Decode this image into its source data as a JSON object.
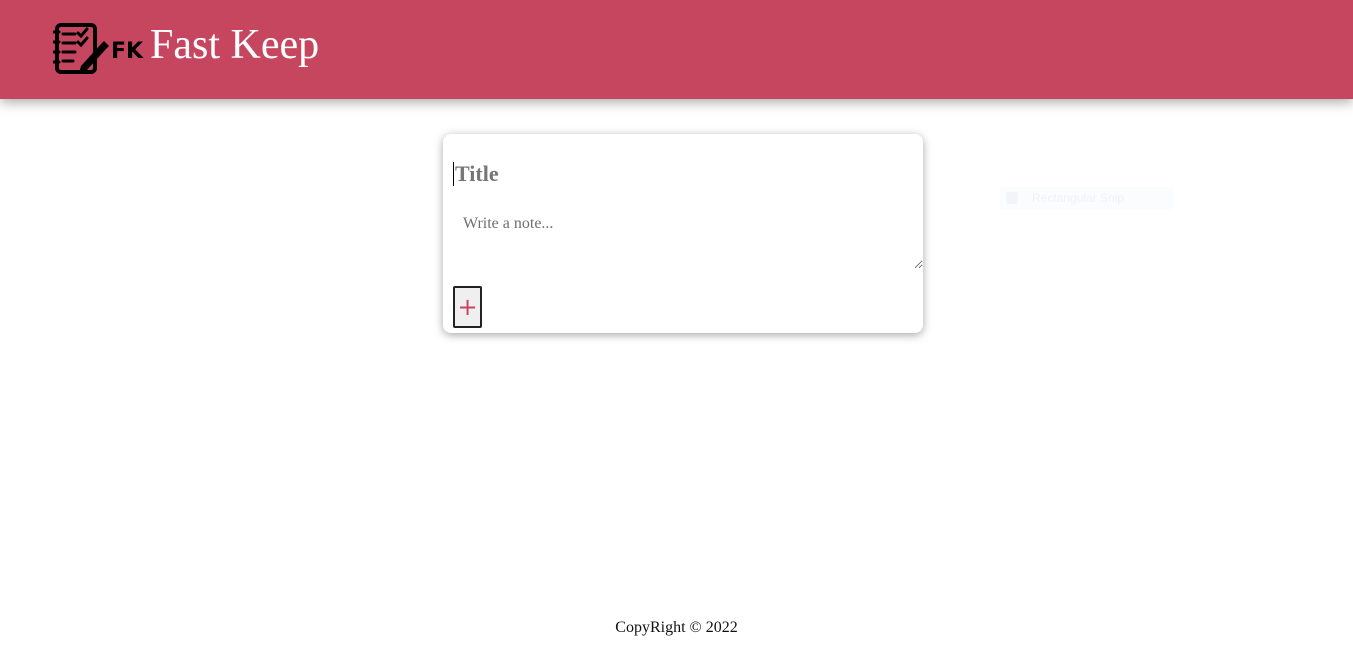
{
  "header": {
    "brand_title": "Fast Keep",
    "logo_icon": "notepad-checklist-pen-icon",
    "logo_text": "FK",
    "background_color": "#c64660"
  },
  "note_form": {
    "title_placeholder": "Title",
    "note_placeholder": "Write a note...",
    "add_button_label": "+",
    "add_icon": "plus-icon",
    "accent_color": "#c64660"
  },
  "ghost_widget": {
    "label": "Rectangular Snip"
  },
  "footer": {
    "text": "CopyRight © 2022"
  }
}
